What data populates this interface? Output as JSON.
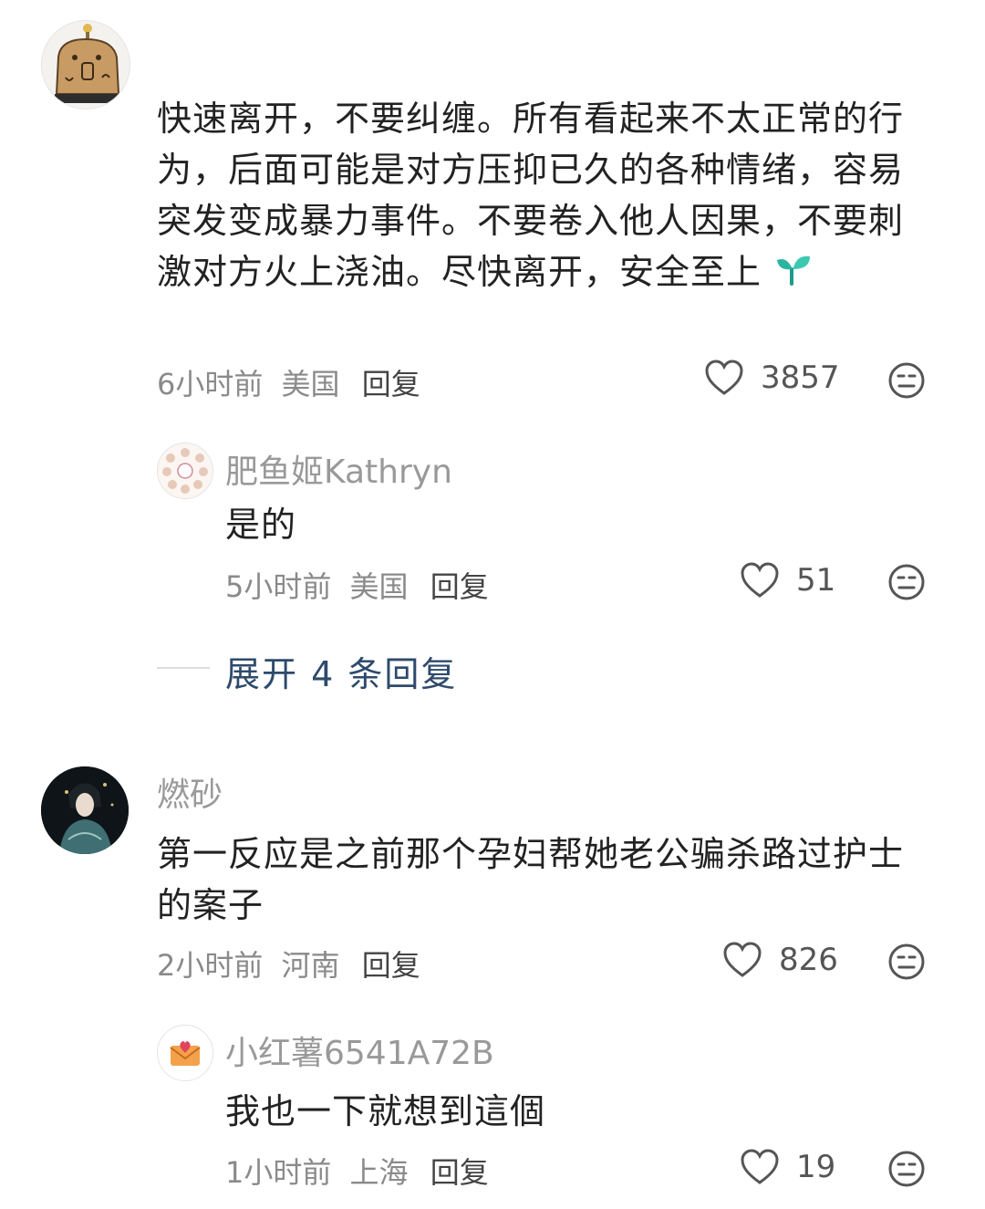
{
  "comments": [
    {
      "avatar_icon": "capybara-avatar",
      "text": "快速离开，不要纠缠。所有看起来不太正常的行为，后面可能是对方压抑已久的各种情绪，容易突发变成暴力事件。不要卷入他人因果，不要刺激对方火上浇油。尽快离开，安全至上",
      "emoji": "sprout-icon",
      "time": "6小时前",
      "location": "美国",
      "reply_label": "回复",
      "likes": "3857",
      "replies": [
        {
          "avatar_icon": "bunny-ring-avatar",
          "username": "肥鱼姬Kathryn",
          "text": "是的",
          "time": "5小时前",
          "location": "美国",
          "reply_label": "回复",
          "likes": "51"
        }
      ],
      "expand_label": "展开 4 条回复"
    },
    {
      "avatar_icon": "costume-portrait-avatar",
      "username": "燃砂",
      "text": "第一反应是之前那个孕妇帮她老公骗杀路过护士的案子",
      "time": "2小时前",
      "location": "河南",
      "reply_label": "回复",
      "likes": "826",
      "replies": [
        {
          "avatar_icon": "envelope-heart-avatar",
          "username": "小红薯6541A72B",
          "text": "我也一下就想到這個",
          "time": "1小时前",
          "location": "上海",
          "reply_label": "回复",
          "likes": "19"
        }
      ]
    }
  ],
  "colors": {
    "link": "#2e4a6b",
    "meta": "#8a8a8a",
    "sprout": "#2bb5a0"
  }
}
